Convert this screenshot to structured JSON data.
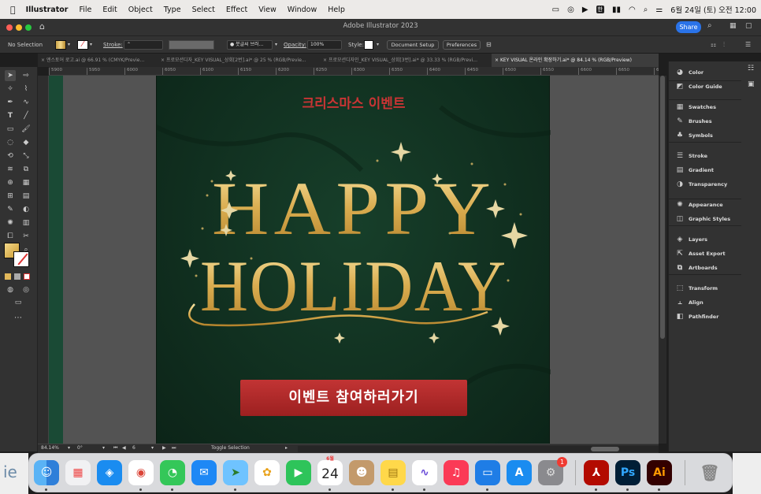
{
  "menubar": {
    "app": "Illustrator",
    "items": [
      "File",
      "Edit",
      "Object",
      "Type",
      "Select",
      "Effect",
      "View",
      "Window",
      "Help"
    ],
    "datetime": "6월 24일 (토) 오전 12:00"
  },
  "window": {
    "title": "Adobe Illustrator 2023",
    "share_label": "Share"
  },
  "control": {
    "selection": "No Selection",
    "stroke_label": "Stroke:",
    "brush": "● 붓글씨 브러...",
    "opacity_label": "Opacity:",
    "opacity_value": "100%",
    "style_label": "Style:",
    "document_setup": "Document Setup",
    "preferences": "Preferences"
  },
  "tabs": [
    {
      "label": "엔스토어 로고.ai @ 66.91 % (CMYK/Previe..."
    },
    {
      "label": "프로모션디자_KEY VISUAL_상회[2번].ai* @ 25 % (RGB/Previe..."
    },
    {
      "label": "프로모션디자인_KEY VISUAL_상회[3번].ai* @ 33.33 % (RGB/Previ..."
    },
    {
      "label": "KEY VISUAL 온라인 확장하기.ai* @ 84.14 % (RGB/Preview)"
    }
  ],
  "ruler": {
    "ticks": [
      "5900",
      "5950",
      "6000",
      "6050",
      "6100",
      "6150",
      "6200",
      "6250",
      "6300",
      "6350",
      "6400",
      "6450",
      "6500",
      "6550",
      "6600",
      "6650",
      "670"
    ]
  },
  "artwork": {
    "title_kr": "크리스마스 이벤트",
    "line1": "HAPPY",
    "line2": "HOLIDAY",
    "cta": "이벤트 참여하러가기",
    "colors": {
      "bg": "#0e2a1c",
      "gold": "#e0b85a",
      "red": "#b52a2a"
    }
  },
  "panels": [
    {
      "label": "Color",
      "icon": "color-icon"
    },
    {
      "label": "Color Guide",
      "icon": "color-guide-icon"
    },
    {
      "label": "Swatches",
      "icon": "swatches-icon"
    },
    {
      "label": "Brushes",
      "icon": "brushes-icon"
    },
    {
      "label": "Symbols",
      "icon": "symbols-icon"
    },
    {
      "label": "Stroke",
      "icon": "stroke-icon"
    },
    {
      "label": "Gradient",
      "icon": "gradient-icon"
    },
    {
      "label": "Transparency",
      "icon": "transparency-icon"
    },
    {
      "label": "Appearance",
      "icon": "appearance-icon"
    },
    {
      "label": "Graphic Styles",
      "icon": "graphic-styles-icon"
    },
    {
      "label": "Layers",
      "icon": "layers-icon"
    },
    {
      "label": "Asset Export",
      "icon": "asset-export-icon"
    },
    {
      "label": "Artboards",
      "icon": "artboards-icon"
    },
    {
      "label": "Transform",
      "icon": "transform-icon"
    },
    {
      "label": "Align",
      "icon": "align-icon"
    },
    {
      "label": "Pathfinder",
      "icon": "pathfinder-icon"
    }
  ],
  "status": {
    "zoom": "84.14%",
    "angle": "0°",
    "artboard": "6",
    "toggle": "Toggle Selection"
  },
  "dock": {
    "calendar_month": "6월",
    "calendar_day": "24",
    "settings_badge": "1",
    "ps_label": "Ps",
    "ai_label": "Ai",
    "edge_text": "ie"
  }
}
